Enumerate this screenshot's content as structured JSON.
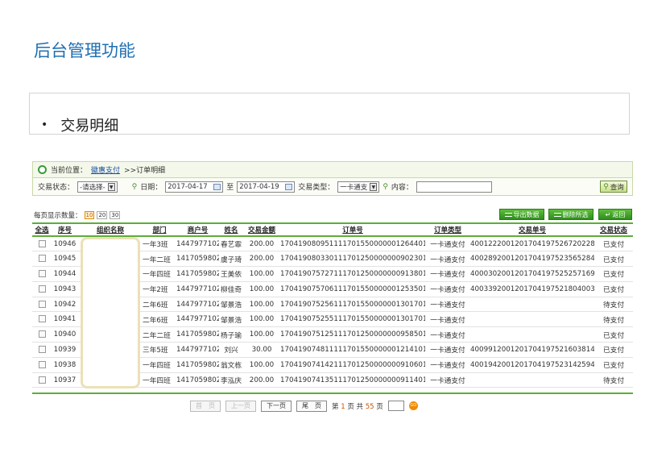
{
  "page": {
    "title": "后台管理功能"
  },
  "section": {
    "bullet": "•",
    "title": "交易明细"
  },
  "breadcrumb": {
    "prefix": "当前位置：",
    "link": "徽惠支付",
    "rest": ">>订单明细"
  },
  "filters": {
    "status_label": "交易状态：",
    "status_value": "-请选择-",
    "date_label": "日期：",
    "date_from": "2017-04-17",
    "date_sep": "至",
    "date_to": "2017-04-19",
    "type_label": "交易类型：",
    "type_value": "一卡通支",
    "content_label": "内容：",
    "query_label": "查询"
  },
  "toolbar": {
    "page_size_label": "每页显示数量：",
    "page_sizes": [
      "10",
      "20",
      "30"
    ],
    "export_label": "导出数据",
    "delete_label": "删除所选",
    "back_label": "返回"
  },
  "table": {
    "headers": [
      "全选",
      "序号",
      "组织名称",
      "部门",
      "商户号",
      "姓名",
      "交易金额",
      "订单号",
      "订单类型",
      "交易单号",
      "交易状态"
    ],
    "rows": [
      [
        "10946",
        "一年3班",
        "1447977102",
        "春艺霏",
        "200.00",
        "170419080951111701550000001264401",
        "一卡通支付",
        "4001222001201704197526720228",
        "已支付"
      ],
      [
        "10945",
        "一年二班",
        "1417059802",
        "虞子琦",
        "200.00",
        "170419080330111701250000000902301",
        "一卡通支付",
        "4002892001201704197523565284",
        "已支付"
      ],
      [
        "10944",
        "一年四班",
        "1417059802",
        "王美依",
        "100.00",
        "170419075727111701250000000913801",
        "一卡通支付",
        "4000302001201704197525257169",
        "已支付"
      ],
      [
        "10943",
        "一年2班",
        "1447977102",
        "柳佳奇",
        "100.00",
        "170419075706111701550000001253501",
        "一卡通支付",
        "4003392001201704197521804003",
        "已支付"
      ],
      [
        "10942",
        "二年6班",
        "1447977102",
        "邹景浩",
        "100.00",
        "170419075256111701550000001301701",
        "一卡通支付",
        "",
        "待支付"
      ],
      [
        "10941",
        "二年6班",
        "1447977102",
        "邹景浩",
        "100.00",
        "170419075255111701550000001301701",
        "一卡通支付",
        "",
        "待支付"
      ],
      [
        "10940",
        "二年二班",
        "1417059802",
        "杨子瑜",
        "100.00",
        "170419075125111701250000000958501",
        "一卡通支付",
        "",
        "已支付"
      ],
      [
        "10939",
        "三年5班",
        "1447977102",
        "刘兴",
        "30.00",
        "170419074811111701550000001214101",
        "一卡通支付",
        "4009912001201704197521603814",
        "已支付"
      ],
      [
        "10938",
        "一年四班",
        "1417059802",
        "翁文栋",
        "100.00",
        "170419074142111701250000000910601",
        "一卡通支付",
        "4001942001201704197523142594",
        "已支付"
      ],
      [
        "10937",
        "一年四班",
        "1417059802",
        "李泓庆",
        "200.00",
        "170419074135111701250000000911401",
        "一卡通支付",
        "",
        "待支付"
      ]
    ]
  },
  "pager": {
    "first": "首　页",
    "prev": "上一页",
    "next": "下一页",
    "last": "尾　页",
    "text_before": "第",
    "current_page": "1",
    "text_mid": "页 共",
    "total_pages": "55",
    "text_after": "页",
    "go_label": "GO"
  },
  "colors": {
    "brand_blue": "#1f6fb2",
    "accent_green": "#5cae3a",
    "orange": "#f08a00"
  }
}
